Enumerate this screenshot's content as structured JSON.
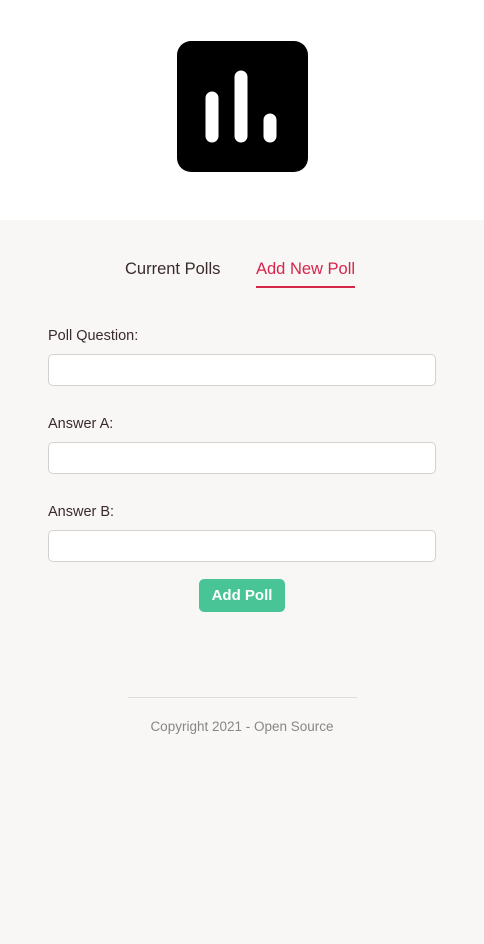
{
  "header": {
    "logo_icon": "bar-chart-icon",
    "logo_bg": "#000000"
  },
  "tabs": [
    {
      "label": "Current Polls",
      "active": false
    },
    {
      "label": "Add New Poll",
      "active": true
    }
  ],
  "form": {
    "question_label": "Poll Question:",
    "question_value": "",
    "answer_a_label": "Answer A:",
    "answer_a_value": "",
    "answer_b_label": "Answer B:",
    "answer_b_value": "",
    "submit_label": "Add Poll"
  },
  "footer": {
    "copyright": "Copyright 2021 - Open Source"
  },
  "colors": {
    "accent": "#d6244a",
    "button": "#48c496",
    "background": "#f8f7f6"
  }
}
